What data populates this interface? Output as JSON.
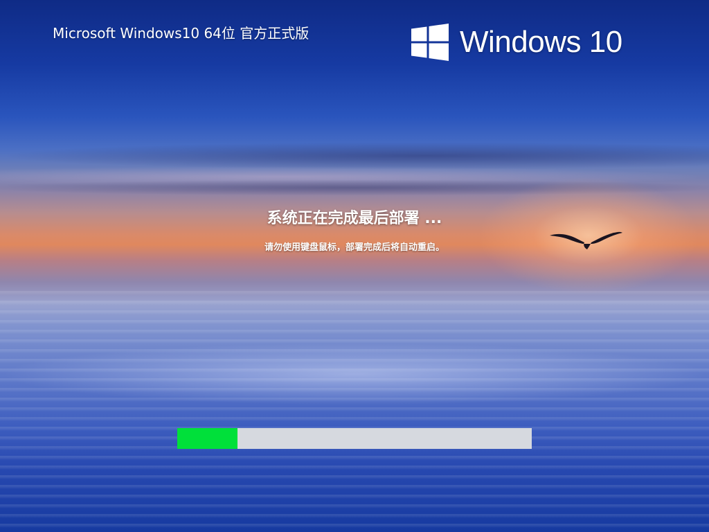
{
  "header": {
    "title": "Microsoft Windows10 64位 官方正式版"
  },
  "brand": {
    "logo_icon": "windows-logo-icon",
    "text": "Windows 10"
  },
  "status": {
    "message": "系统正在完成最后部署 ...",
    "hint": "请勿使用键盘鼠标，部署完成后将自动重启。"
  },
  "progress": {
    "percent": 17,
    "fill_color": "#00e03a",
    "track_color": "#d6d9df"
  }
}
